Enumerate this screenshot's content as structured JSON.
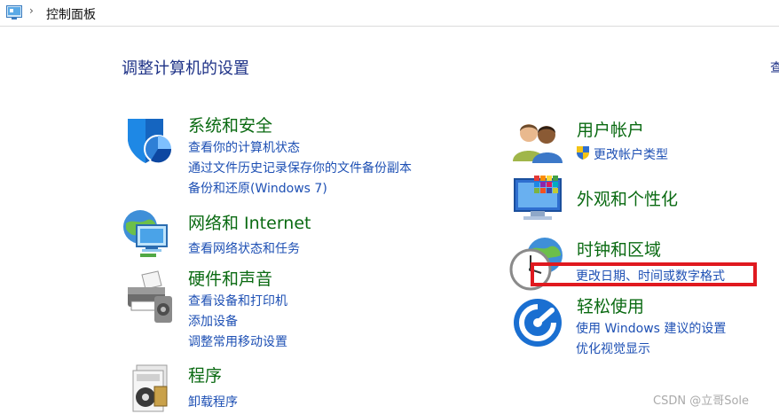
{
  "address_bar": {
    "breadcrumb": "控制面板",
    "icon": "control-panel-icon",
    "separator_icon": "chevron-right-icon"
  },
  "page": {
    "title": "调整计算机的设置",
    "view_link_partial": "查"
  },
  "categories": {
    "system_security": {
      "icon": "shield-icon",
      "title": "系统和安全",
      "links": [
        "查看你的计算机状态",
        "通过文件历史记录保存你的文件备份副本",
        "备份和还原(Windows 7)"
      ]
    },
    "network": {
      "icon": "network-globe-icon",
      "title": "网络和 Internet",
      "links": [
        "查看网络状态和任务"
      ]
    },
    "hardware_sound": {
      "icon": "printer-icon",
      "title": "硬件和声音",
      "links": [
        "查看设备和打印机",
        "添加设备",
        "调整常用移动设置"
      ]
    },
    "programs": {
      "icon": "programs-icon",
      "title": "程序",
      "links": [
        "卸载程序"
      ]
    },
    "user_accounts": {
      "icon": "users-icon",
      "title": "用户帐户",
      "links": [
        "更改帐户类型"
      ],
      "link_icon": "uac-shield-icon"
    },
    "appearance": {
      "icon": "appearance-monitor-icon",
      "title": "外观和个性化",
      "links": []
    },
    "clock_region": {
      "icon": "clock-globe-icon",
      "title": "时钟和区域",
      "links": [
        "更改日期、时间或数字格式"
      ]
    },
    "ease_access": {
      "icon": "ease-of-access-icon",
      "title": "轻松使用",
      "links": [
        "使用 Windows 建议的设置",
        "优化视觉显示"
      ]
    }
  },
  "annotation": {
    "highlight_color": "#e0191f"
  },
  "watermark": "CSDN @立哥Sole",
  "colors": {
    "category_title": "#0a6a12",
    "link": "#1e50b4",
    "heading": "#1e3287"
  }
}
